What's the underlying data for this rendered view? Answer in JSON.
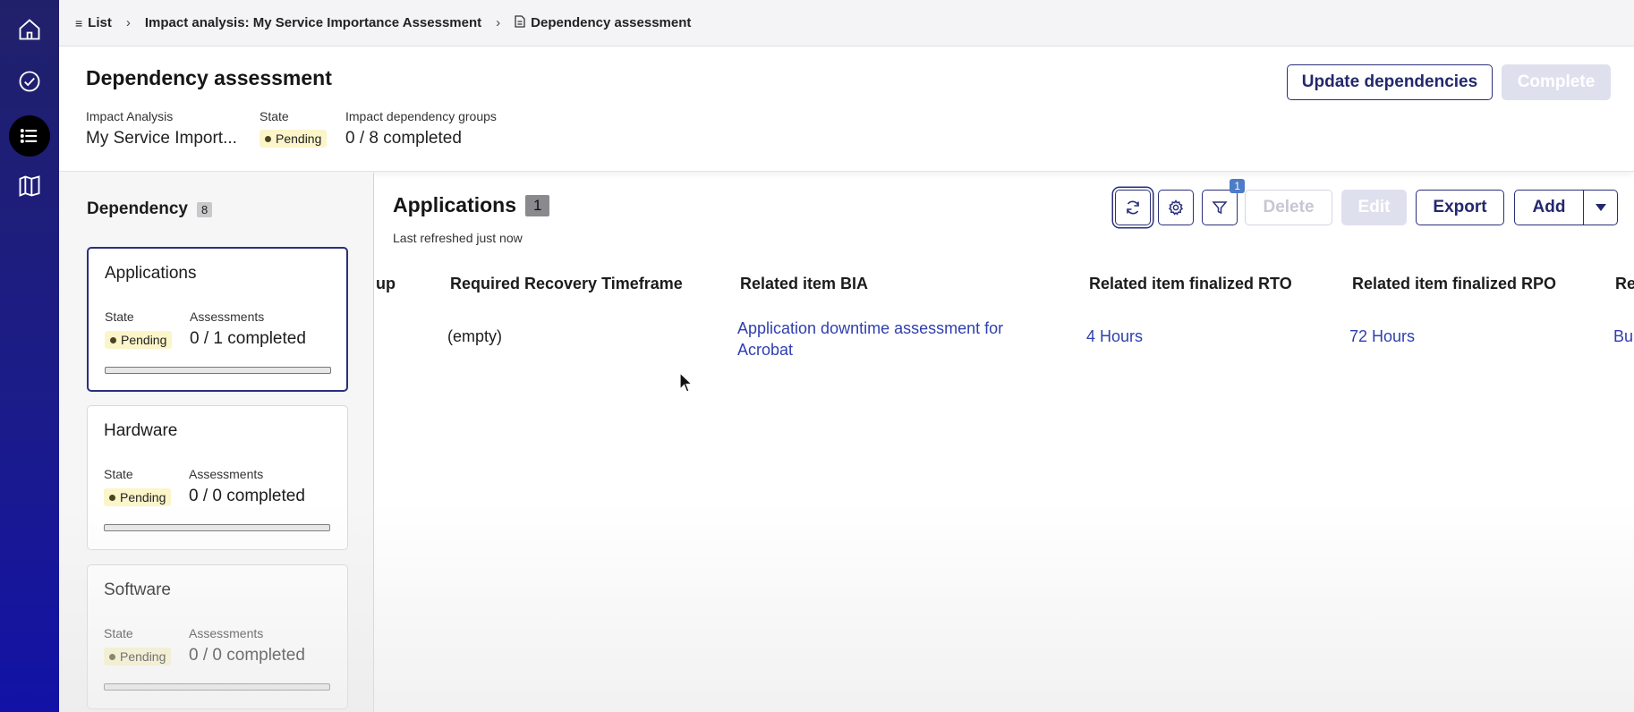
{
  "breadcrumb": {
    "list": "List",
    "impact": "Impact analysis: My Service Importance Assessment",
    "current": "Dependency assessment"
  },
  "header": {
    "title": "Dependency assessment",
    "impact_analysis_label": "Impact Analysis",
    "impact_analysis_value": "My Service Import...",
    "state_label": "State",
    "state_value": "Pending",
    "groups_label": "Impact dependency groups",
    "groups_value": "0 / 8 completed",
    "update_button": "Update dependencies",
    "complete_button": "Complete"
  },
  "dependency_panel": {
    "title": "Dependency",
    "count": "8",
    "cards": [
      {
        "title": "Applications",
        "state_label": "State",
        "state": "Pending",
        "assess_label": "Assessments",
        "assessments": "0 / 1 completed",
        "progress": 0
      },
      {
        "title": "Hardware",
        "state_label": "State",
        "state": "Pending",
        "assess_label": "Assessments",
        "assessments": "0 / 0 completed",
        "progress": 0
      },
      {
        "title": "Software",
        "state_label": "State",
        "state": "Pending",
        "assess_label": "Assessments",
        "assessments": "0 / 0 completed",
        "progress": 0
      }
    ]
  },
  "list": {
    "title": "Applications",
    "count": "1",
    "refreshed": "Last refreshed just now",
    "filter_count": "1",
    "buttons": {
      "delete": "Delete",
      "edit": "Edit",
      "export": "Export",
      "add": "Add"
    },
    "icons": {
      "refresh": "refresh-icon",
      "settings": "gear-icon",
      "filter": "filter-icon",
      "dropdown": "caret-down-icon"
    },
    "columns": [
      "up",
      "Required Recovery Timeframe",
      "Related item BIA",
      "Related item finalized RTO",
      "Related item finalized RPO",
      "Re"
    ],
    "rows": [
      {
        "timeframe": "(empty)",
        "bia_line1": "Application downtime assessment for",
        "bia_line2": "Acrobat",
        "rto": "4 Hours",
        "rpo": "72 Hours",
        "extra": "Bu"
      }
    ]
  },
  "colors": {
    "accent": "#2a2f7a",
    "link": "#2f3fae",
    "pending_bg": "#fbf5c9",
    "rail": "#1b1b8c"
  }
}
